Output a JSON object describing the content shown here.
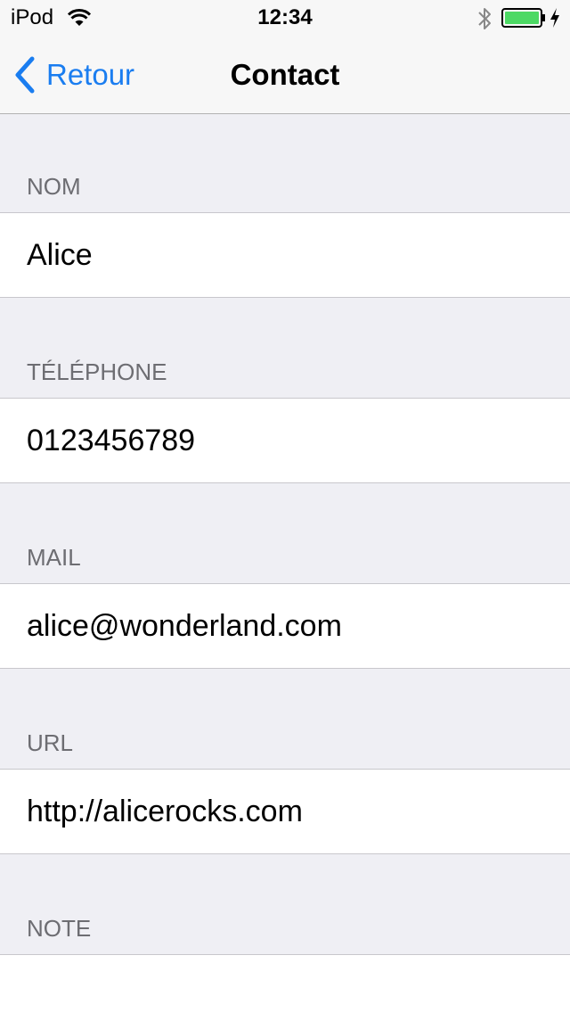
{
  "status_bar": {
    "carrier": "iPod",
    "time": "12:34",
    "battery_color": "#4cd964"
  },
  "nav": {
    "back_label": "Retour",
    "title": "Contact",
    "accent_color": "#1a7df0"
  },
  "fields": [
    {
      "header": "NOM",
      "value": "Alice"
    },
    {
      "header": "TÉLÉPHONE",
      "value": "0123456789"
    },
    {
      "header": "MAIL",
      "value": "alice@wonderland.com"
    },
    {
      "header": "URL",
      "value": "http://alicerocks.com"
    },
    {
      "header": "NOTE",
      "value": ""
    }
  ],
  "icons": {
    "wifi": "wifi-icon",
    "bluetooth": "bluetooth-icon",
    "battery": "battery-icon",
    "charging": "charging-bolt-icon",
    "back": "chevron-left-icon"
  }
}
